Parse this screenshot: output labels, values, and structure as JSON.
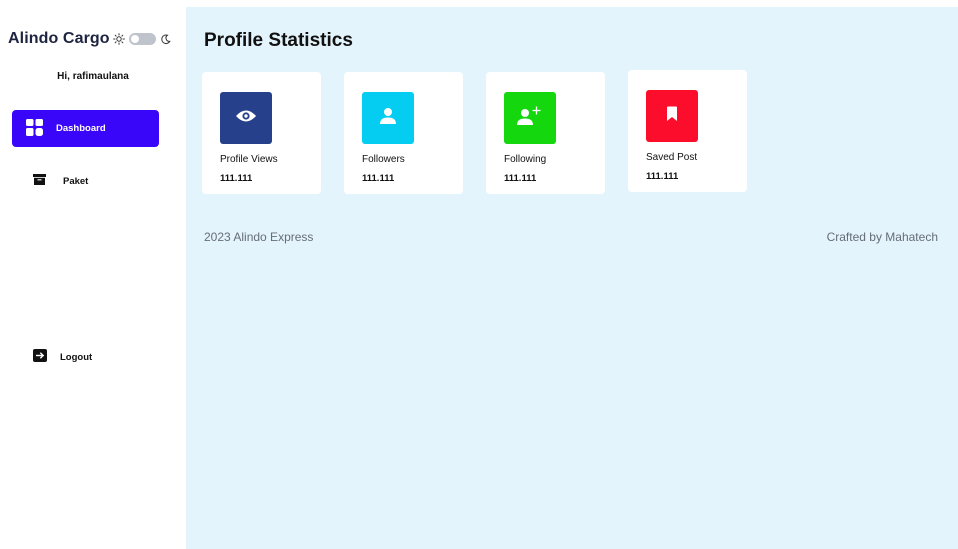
{
  "sidebar": {
    "brand": "Alindo Cargo",
    "greeting": "Hi, rafimaulana",
    "items": [
      {
        "label": "Dashboard",
        "icon": "dashboard-grid-icon",
        "active": true
      },
      {
        "label": "Paket",
        "icon": "package-box-icon",
        "active": false
      },
      {
        "label": "Logout",
        "icon": "logout-arrow-icon",
        "active": false
      }
    ],
    "theme_toggle": {
      "light_icon": "sun-icon",
      "dark_icon": "moon-icon",
      "state": "light"
    }
  },
  "main": {
    "title": "Profile Statistics",
    "cards": [
      {
        "label": "Profile Views",
        "value": "111.111",
        "color": "#27408b",
        "icon": "eye-icon"
      },
      {
        "label": "Followers",
        "value": "111.111",
        "color": "#05cdf1",
        "icon": "user-icon"
      },
      {
        "label": "Following",
        "value": "111.111",
        "color": "#14d70e",
        "icon": "user-plus-icon"
      },
      {
        "label": "Saved Post",
        "value": "111.111",
        "color": "#fc0d2b",
        "icon": "bookmark-icon"
      }
    ]
  },
  "footer": {
    "left": "2023 Alindo Express",
    "right": "Crafted by Mahatech"
  },
  "colors": {
    "accent": "#3a06f9",
    "main_background": "#e4f4fc",
    "brand_text": "#1e2340"
  }
}
